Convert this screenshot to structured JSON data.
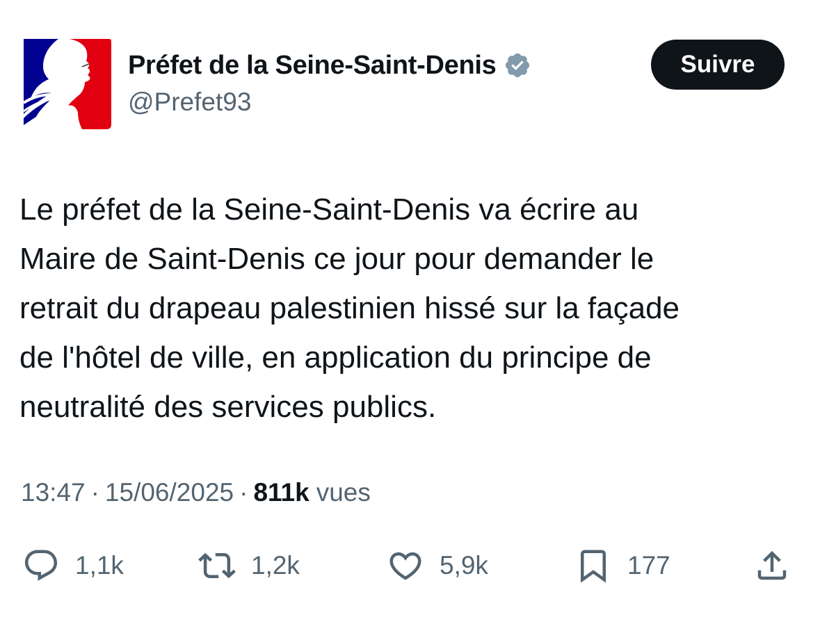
{
  "account": {
    "display_name": "Préfet de la Seine-Saint-Denis",
    "handle": "@Prefet93",
    "verified": true,
    "avatar_icon": "marianne-logo-icon",
    "verified_icon": "verified-badge-icon"
  },
  "follow_button": {
    "label": "Suivre"
  },
  "tweet": {
    "text": "Le préfet de la Seine-Saint-Denis va écrire au\nMaire de Saint-Denis ce jour pour demander le\nretrait du drapeau palestinien hissé sur la façade\nde l'hôtel de ville, en application du principe de\nneutralité des services publics."
  },
  "meta": {
    "time": "13:47",
    "separator": "·",
    "date": "15/06/2025",
    "views_count": "811k",
    "views_label": "vues"
  },
  "actions": {
    "reply": {
      "icon": "reply-icon",
      "count": "1,1k"
    },
    "retweet": {
      "icon": "retweet-icon",
      "count": "1,2k"
    },
    "like": {
      "icon": "heart-icon",
      "count": "5,9k"
    },
    "bookmark": {
      "icon": "bookmark-icon",
      "count": "177"
    },
    "share": {
      "icon": "share-icon"
    }
  },
  "colors": {
    "text_primary": "#0f1419",
    "text_secondary": "#536471",
    "flag_blue": "#000091",
    "flag_red": "#e1000f",
    "verified_badge": "#829aab",
    "button_bg": "#0f1419"
  }
}
